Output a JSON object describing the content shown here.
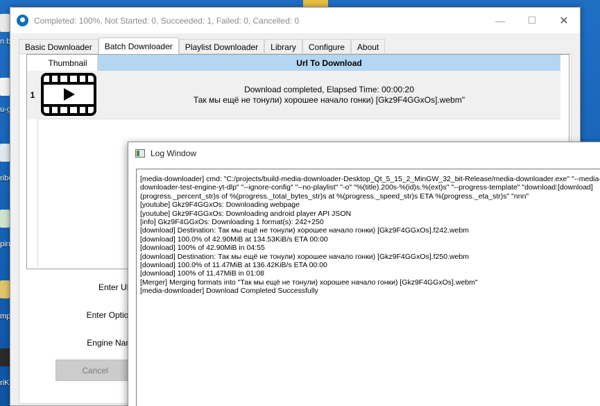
{
  "desktop": {
    "icons": [
      {
        "label": "n b"
      },
      {
        "label": "u-g"
      },
      {
        "label": "ribo"
      },
      {
        "label": "pin"
      },
      {
        "label": "mp"
      },
      {
        "label": "riKa"
      }
    ]
  },
  "window": {
    "title": "Completed: 100%, Not Started: 0, Succeeded: 1, Failed: 0, Cancelled: 0",
    "controls": {
      "minimize": "—",
      "maximize": "☐",
      "close": "✕"
    }
  },
  "tabs": [
    {
      "label": "Basic Downloader",
      "active": false
    },
    {
      "label": "Batch Downloader",
      "active": true
    },
    {
      "label": "Playlist Downloader",
      "active": false
    },
    {
      "label": "Library",
      "active": false
    },
    {
      "label": "Configure",
      "active": false
    },
    {
      "label": "About",
      "active": false
    }
  ],
  "table": {
    "headers": {
      "thumbnail": "Thumbnail",
      "url": "Url To Download"
    },
    "rows": [
      {
        "number": "1",
        "thumbnail_icon": "video-file-icon",
        "line1": "Download completed, Elapsed Time: 00:00:20",
        "line2": "Так мы ещё не тонули) хорошее начало гонки) [Gkz9F4GGxOs].webm\""
      }
    ]
  },
  "form": {
    "url_label": "Enter URL",
    "options_label": "Enter Options",
    "engine_label": "Engine Name",
    "cancel_label": "Cancel"
  },
  "log_window": {
    "title": "Log Window",
    "close": "✕",
    "lines": [
      "[media-downloader] cmd: \"C:/projects/build-media-downloader-Desktop_Qt_5_15_2_MinGW_32_bit-Release/media-downloader.exe\" \"--media-",
      "downloader-test-engine-yt-dlp\" \"--ignore-config\" \"--no-playlist\" \"-o\" \"%(title).200s-%(id)s.%(ext)s\" \"--progress-template\" \"download:[download]",
      "(progress._percent_str)s of %(progress._total_bytes_str)s at %(progress._speed_str)s ETA %(progress._eta_str)s\" \"nnn\"",
      "[youtube] Gkz9F4GGxOs: Downloading webpage",
      "[youtube] Gkz9F4GGxOs: Downloading android player API JSON",
      "[info] Gkz9F4GGxOs: Downloading 1 format(s): 242+250",
      "[download] Destination: Так мы ещё не тонули) хорошее начало гонки) [Gkz9F4GGxOs].f242.webm",
      "[download] 100.0% of 42.90MiB at  134.53KiB/s ETA 00:00",
      "[download] 100% of 42.90MiB in 04:55",
      "[download] Destination: Так мы ещё не тонули) хорошее начало гонки) [Gkz9F4GGxOs].f250.webm",
      "[download] 100.0% of 11.47MiB at  136.42KiB/s ETA 00:00",
      "[download] 100% of 11.47MiB in 01:08",
      "[Merger] Merging formats into \"Так мы ещё не тонули) хорошее начало гонки) [Gkz9F4GGxOs].webm\"",
      "[media-downloader] Download Completed Successfully"
    ]
  }
}
